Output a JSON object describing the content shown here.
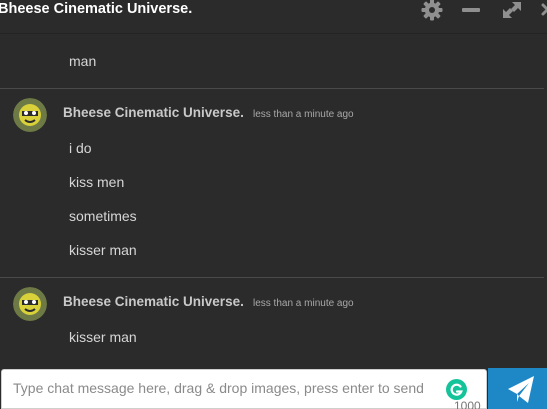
{
  "window": {
    "title": "Bheese Cinematic Universe.",
    "icons": [
      "gear-icon",
      "minimize-icon",
      "expand-icon",
      "close-icon"
    ]
  },
  "messages": [
    {
      "continued": true,
      "lines": [
        "man"
      ]
    },
    {
      "author": "Bheese Cinematic Universe.",
      "time": "less than a minute ago",
      "lines": [
        "i do",
        "kiss men",
        "sometimes",
        "kisser man"
      ]
    },
    {
      "author": "Bheese Cinematic Universe.",
      "time": "less than a minute ago",
      "lines": [
        "kisser man"
      ]
    }
  ],
  "composer": {
    "placeholder": "Type chat message here, drag & drop images, press enter to send",
    "char_limit": "1000",
    "send_icon": "paper-plane-icon",
    "grammarly_icon": "grammarly-icon"
  },
  "colors": {
    "background": "#2b2b2b",
    "send_button": "#1e88c7",
    "grammarly": "#15c39a"
  }
}
